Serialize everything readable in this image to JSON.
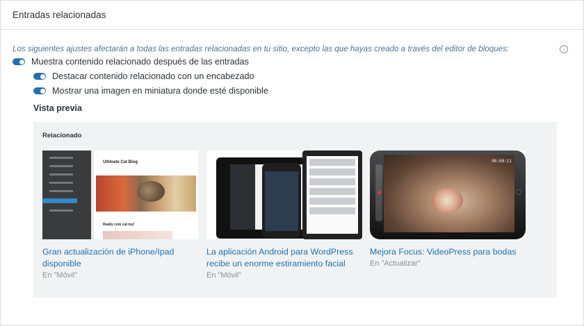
{
  "header": {
    "title": "Entradas relacionadas"
  },
  "notice": "Los siguientes ajustes afectarán a todas las entradas relacionadas en tu sitio, excepto las que hayas creado a través del editor de bloques:",
  "toggles": [
    {
      "label": "Muestra contenido relacionado después de las entradas",
      "on": true
    },
    {
      "label": "Destacar contenido relacionado con un encabezado",
      "on": true
    },
    {
      "label": "Mostrar una imagen en miniatura donde esté disponible",
      "on": true
    }
  ],
  "preview": {
    "title": "Vista previa",
    "related_label": "Relacionado",
    "posts": [
      {
        "title": "Gran actualización de iPhone/Ipad disponible",
        "category": "En \"Móvil\"",
        "thumb": {
          "blog_title": "Ultimate Cat Blog",
          "caption": "Really cute cat toy!"
        }
      },
      {
        "title": "La aplicación Android para WordPress recibe un enorme estiramiento facial",
        "category": "En \"Móvil\""
      },
      {
        "title": "Mejora Focus: VideoPress para bodas",
        "category": "En \"Actualizar\"",
        "thumb": {
          "time": "00:00:11"
        }
      }
    ]
  },
  "colors": {
    "accent": "#2271b1",
    "notice": "#4f748e",
    "muted": "#8c8f94"
  },
  "icons": {
    "info": "info-icon"
  }
}
